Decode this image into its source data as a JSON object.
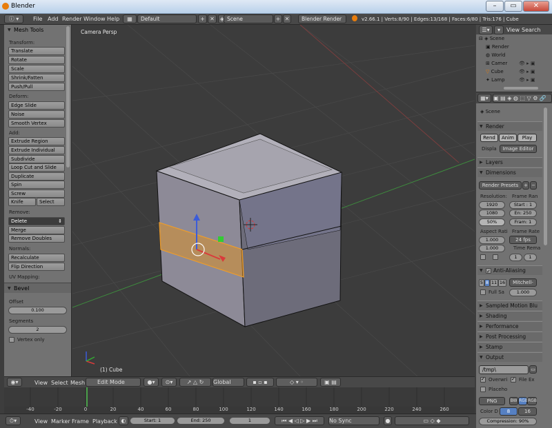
{
  "window": {
    "title": "Blender"
  },
  "topbar": {
    "menus": [
      "File",
      "Add",
      "Render",
      "Window",
      "Help"
    ],
    "layout": "Default",
    "scene": "Scene",
    "engine": "Blender Render",
    "stats": "v2.66.1 | Verts:8/90 | Edges:13/168 | Faces:6/80 | Tris:176 | Cube"
  },
  "toolshelf": {
    "title": "Mesh Tools",
    "transform": {
      "label": "Transform:",
      "items": [
        "Translate",
        "Rotate",
        "Scale",
        "Shrink/Fatten",
        "Push/Pull"
      ]
    },
    "deform": {
      "label": "Deform:",
      "items": [
        "Edge Slide",
        "Noise",
        "Smooth Vertex"
      ]
    },
    "add": {
      "label": "Add:",
      "items": [
        "Extrude Region",
        "Extrude Individual",
        "Subdivide",
        "Loop Cut and Slide",
        "Duplicate",
        "Spin",
        "Screw"
      ],
      "knife": "Knife",
      "select": "Select"
    },
    "remove": {
      "label": "Remove:",
      "delete": "Delete",
      "merge": "Merge",
      "remove_doubles": "Remove Doubles"
    },
    "normals": {
      "label": "Normals:",
      "recalculate": "Recalculate",
      "flip": "Flip Direction"
    },
    "uv": {
      "label": "UV Mapping:"
    },
    "bevel": {
      "title": "Bevel",
      "offset_label": "Offset",
      "offset_value": "0.100",
      "segments_label": "Segments",
      "segments_value": "2",
      "vertex_only": "Vertex only"
    }
  },
  "viewport": {
    "label": "Camera Persp",
    "object": "(1) Cube"
  },
  "viewheader": {
    "view": "View",
    "select": "Select",
    "mesh": "Mesh",
    "mode": "Edit Mode",
    "orientation": "Global"
  },
  "timeline": {
    "ticks": [
      "-40",
      "-20",
      "0",
      "20",
      "40",
      "60",
      "80",
      "100",
      "120",
      "140",
      "160",
      "180",
      "200",
      "220",
      "240",
      "260"
    ],
    "current_frame": 1
  },
  "timebar": {
    "view": "View",
    "marker": "Marker",
    "frame": "Frame",
    "playback": "Playback",
    "start": "Start: 1",
    "end": "End: 250",
    "current": "1",
    "sync": "No Sync"
  },
  "outliner": {
    "view": "View",
    "search": "Search",
    "items": [
      "Scene",
      "Render",
      "World",
      "Camer",
      "Cube",
      "Lamp"
    ]
  },
  "properties": {
    "scene": "Scene",
    "render_title": "Render",
    "render_btn": "Rend",
    "anim_btn": "Anim",
    "play_btn": "Play",
    "display_label": "Displa",
    "display_value": "Image Editor",
    "layers": "Layers",
    "dimensions": "Dimensions",
    "render_presets": "Render Presets",
    "resolution": "Resolution:",
    "frame_range": "Frame Ran",
    "res_x": "1920",
    "res_y": "1080",
    "res_pct": "50%",
    "start": "Start : 1",
    "end": "En: 250",
    "frame": "Fram: 1",
    "aspect": "Aspect Rati",
    "frame_rate": "Frame Rate",
    "aspect_x": "1.000",
    "aspect_y": "1.000",
    "fps": "24 fps",
    "time_remap": "Time Rema",
    "remap_old": "1",
    "remap_new": "1",
    "antialiasing": "Anti-Aliasing",
    "aa_samples": [
      "5",
      "8",
      "11",
      "16"
    ],
    "aa_filter": "Mitchell-",
    "full_sample": "Full Sa",
    "filter_size": "1.000",
    "sampled_motion": "Sampled Motion Blu",
    "shading": "Shading",
    "performance": "Performance",
    "post_processing": "Post Processing",
    "stamp": "Stamp",
    "output": "Output",
    "output_path": "/tmp\\",
    "overwrite": "Overwri",
    "file_ext": "File Ex",
    "placeholders": "Placeho",
    "format": "PNG",
    "bw": "BW",
    "rgb": "RGB",
    "rgba": "RGB",
    "color_depth_label": "Color D",
    "depth_8": "8",
    "depth_16": "16",
    "compression": "Compression: 90%"
  },
  "colors": {
    "accent": "#5680c2",
    "select_orange": "#f0a030",
    "grid_green": "#3e8c3e",
    "grid_red": "#8c3e3e"
  }
}
